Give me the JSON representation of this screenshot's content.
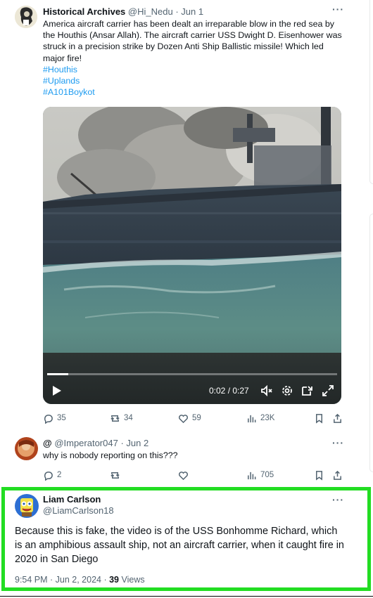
{
  "tweet1": {
    "name": "Historical Archives",
    "handle": "@Hi_Nedu",
    "date": "· Jun 1",
    "text": "America aircraft carrier has been dealt an irreparable blow in the red sea by the Houthis (Ansar Allah). The aircraft carrier USS Dwight D. Eisenhower was struck in a precision strike by Dozen Anti Ship Ballistic missile! Which led major fire!",
    "hashtags": [
      "#Houthis",
      "#Uplands",
      "#A101Boykot"
    ],
    "video": {
      "time": "0:02 / 0:27",
      "progress": 0.074
    },
    "replies": "35",
    "reposts": "34",
    "likes": "59",
    "views": "23K"
  },
  "tweet2": {
    "name": "@",
    "handle": "@Imperator047",
    "date": "· Jun 2",
    "text": "why is nobody reporting on this???",
    "replies": "2",
    "reposts": "",
    "likes": "",
    "views": "705"
  },
  "tweet3": {
    "name": "Liam Carlson",
    "handle": "@LiamCarlson18",
    "text": "Because this is fake, the video is of the USS Bonhomme Richard, which is an amphibious assault ship, not an aircraft carrier, when it caught fire in 2020 in San Diego",
    "timestamp": "9:54 PM · Jun 2, 2024 · ",
    "views_count": "39",
    "views_label": " Views"
  },
  "colors": {
    "link": "#1d9bf0",
    "highlight": "#22dd22",
    "muted": "#536471"
  }
}
